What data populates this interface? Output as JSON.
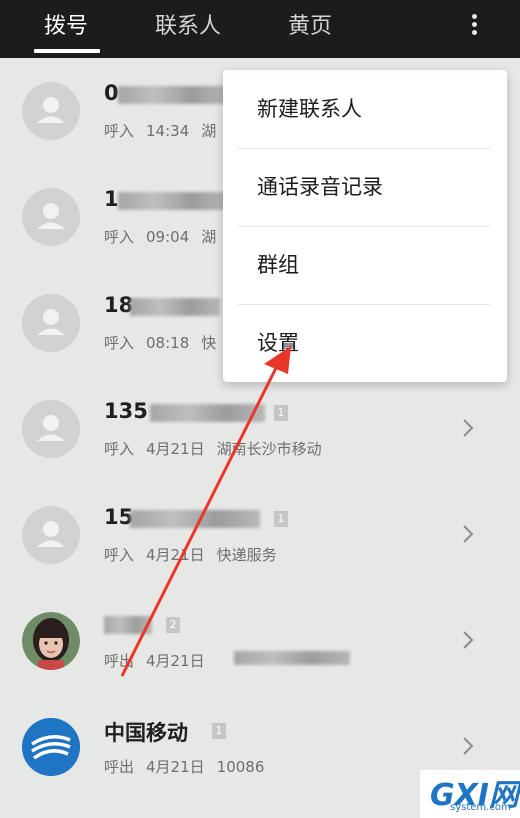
{
  "tabs": [
    {
      "label": "拨号"
    },
    {
      "label": "联系人"
    },
    {
      "label": "黄页"
    }
  ],
  "menu": {
    "items": [
      {
        "label": "新建联系人"
      },
      {
        "label": "通话录音记录"
      },
      {
        "label": "群组"
      },
      {
        "label": "设置"
      }
    ]
  },
  "calls": [
    {
      "name": "0",
      "sim": "",
      "type": "呼入",
      "time": "14:34",
      "location": "湖"
    },
    {
      "name": "1",
      "sim": "",
      "type": "呼入",
      "time": "09:04",
      "location": "湖"
    },
    {
      "name": "18",
      "sim": "",
      "type": "呼入",
      "time": "08:18",
      "location": "快"
    },
    {
      "name": "135",
      "sim": "1",
      "type": "呼入",
      "time": "4月21日",
      "location": "湖南长沙市移动"
    },
    {
      "name": "15",
      "sim": "1",
      "type": "呼入",
      "time": "4月21日",
      "location": "快递服务"
    },
    {
      "name": "",
      "sim": "2",
      "type": "呼出",
      "time": "4月21日",
      "location": ""
    },
    {
      "name": "中国移动",
      "sim": "1",
      "type": "呼出",
      "time": "4月21日",
      "location": "10086"
    }
  ],
  "watermark": {
    "big": "GXI网",
    "small": "system.com"
  },
  "colors": {
    "topbar": "#1c1c1c",
    "background": "#e6e8e6",
    "arrow": "#e8362a",
    "brand": "#1f74c4"
  }
}
